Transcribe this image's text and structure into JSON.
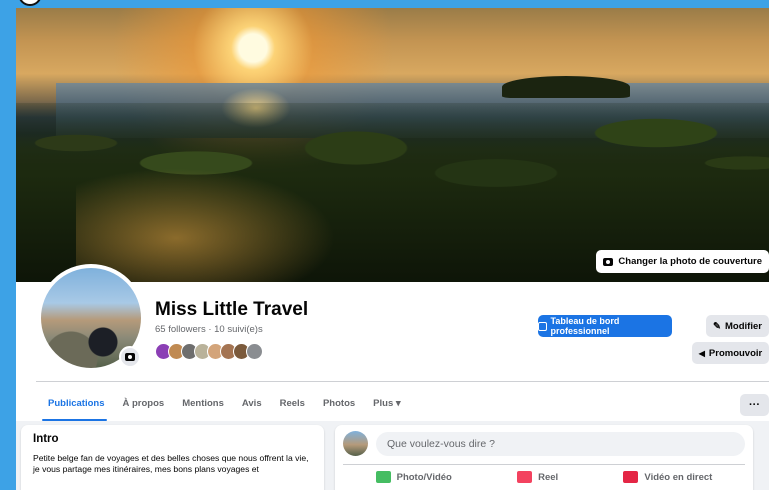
{
  "colors": {
    "accent": "#1b74e4",
    "background": "#3da2e6",
    "photo_video": "#45bd62",
    "reel": "#f3425f",
    "live": "#e42645"
  },
  "cover": {
    "change_cover_label": "Changer la photo de couverture",
    "camera_icon": "camera-icon"
  },
  "profile": {
    "name": "Miss Little Travel",
    "followers": "65 followers · 10 suivi(e)s",
    "friend_avatar_count": 8
  },
  "actions": {
    "dashboard_label": "Tableau de bord professionnel",
    "edit_label": "Modifier",
    "promote_label": "Promouvoir",
    "more_label": "···"
  },
  "tabs": [
    {
      "label": "Publications",
      "active": true
    },
    {
      "label": "À propos",
      "active": false
    },
    {
      "label": "Mentions",
      "active": false
    },
    {
      "label": "Avis",
      "active": false
    },
    {
      "label": "Reels",
      "active": false
    },
    {
      "label": "Photos",
      "active": false
    },
    {
      "label": "Plus ▾",
      "active": false
    }
  ],
  "intro": {
    "title": "Intro",
    "text": "Petite belge fan de voyages et des belles choses que nous offrent la vie, je vous partage mes itinéraires, mes bons plans voyages et"
  },
  "composer": {
    "placeholder": "Que voulez-vous dire ?",
    "buttons": [
      {
        "label": "Photo/Vidéo",
        "icon": "photo-icon"
      },
      {
        "label": "Reel",
        "icon": "reel-icon"
      },
      {
        "label": "Vidéo en direct",
        "icon": "live-video-icon"
      }
    ]
  }
}
